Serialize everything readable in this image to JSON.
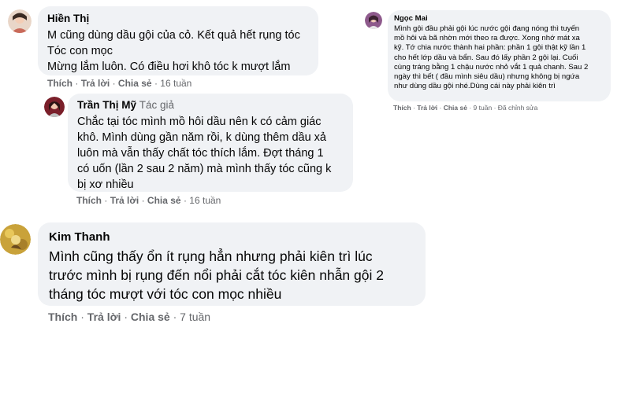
{
  "comments": [
    {
      "author": "Hiền Thị",
      "lines": [
        "M cũng dùng dầu gội của cỏ. Kết quả hết rụng tóc",
        "Tóc con mọc",
        "Mừng lắm luôn. Có điều hơi khô tóc k mượt lắm"
      ],
      "actions": {
        "like": "Thích",
        "reply": "Trả lời",
        "share": "Chia sẻ",
        "time": "16 tuần"
      }
    },
    {
      "author": "Trần Thị Mỹ",
      "badge": "Tác giả",
      "lines": [
        "Chắc tại tóc mình mồ hôi dầu nên k có cảm giác",
        "khô. Mình dùng gần năm rồi, k dùng thêm dầu xả",
        "luôn mà vẫn thấy chất tóc thích lắm. Đợt tháng 1",
        "có uốn (lần 2 sau 2 năm) mà mình thấy tóc cũng k",
        "bị xơ nhiều"
      ],
      "actions": {
        "like": "Thích",
        "reply": "Trả lời",
        "share": "Chia sẻ",
        "time": "16 tuần"
      }
    },
    {
      "author": "Kim Thanh",
      "lines": [
        "Mình cũng thấy ổn ít rụng hẳn nhưng phải kiên trì lúc",
        "trước mình bị rụng đến nổi phải cắt tóc kiên nhẫn gội 2",
        "tháng tóc mượt với tóc con mọc nhiều"
      ],
      "actions": {
        "like": "Thích",
        "reply": "Trả lời",
        "share": "Chia sẻ",
        "time": "7 tuần"
      }
    },
    {
      "author": "Ngọc Mai",
      "lines": [
        "Mình gội đầu phải gội lúc nước gội đang nóng thì tuyến",
        "mồ hôi và bã nhờn mới theo ra được. Xong nhớ mát xa",
        "kỹ. Tớ chia nước thành hai phần: phần 1 gội thật kỹ lần 1",
        "cho hết lớp dầu và bẩn. Sau đó lấy phần 2 gội lại. Cuối",
        "cùng tráng bằng 1 chậu nước nhỏ vắt 1 quả chanh. Sau 2",
        "ngày thì bết ( đầu mình siêu dầu) nhưng không bị ngứa",
        "như dùng dầu gội nhé.Dùng cái này phải kiên trì"
      ],
      "actions": {
        "like": "Thích",
        "reply": "Trả lời",
        "share": "Chia sẻ",
        "time": "9 tuần",
        "edited": "Đã chỉnh sửa"
      }
    }
  ]
}
